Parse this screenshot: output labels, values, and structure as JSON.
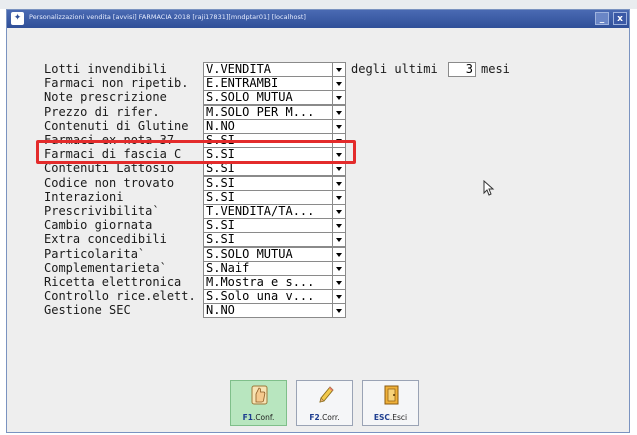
{
  "window": {
    "title": "Personalizzazioni vendita [avvisi] FARMACIA 2018 [raji17831][mndptar01] [localhost]",
    "icon": "app-icon",
    "minimize_label": "_",
    "close_label": "x"
  },
  "form": {
    "rows": [
      {
        "label": "Lotti invendibili",
        "value": "V.VENDITA"
      },
      {
        "label": "Farmaci non ripetib.",
        "value": "E.ENTRAMBI"
      },
      {
        "label": "Note prescrizione",
        "value": "S.SOLO MUTUA"
      },
      {
        "label": "Prezzo di rifer.",
        "value": "M.SOLO PER M..."
      },
      {
        "label": "Contenuti di Glutine",
        "value": "N.NO"
      },
      {
        "label": "Farmaci ex nota 37",
        "value": "S.SI"
      },
      {
        "label": "Farmaci di fascia C",
        "value": "S.SI"
      },
      {
        "label": "Contenuti Lattosio",
        "value": "S.SI"
      },
      {
        "label": "Codice non trovato",
        "value": "S.SI"
      },
      {
        "label": "Interazioni",
        "value": "S.SI"
      },
      {
        "label": "Prescrivibilita`",
        "value": "T.VENDITA/TA..."
      },
      {
        "label": "Cambio giornata",
        "value": "S.SI"
      },
      {
        "label": "Extra concedibili",
        "value": "S.SI"
      },
      {
        "label": "Particolarita`",
        "value": "S.SOLO MUTUA"
      },
      {
        "label": "Complementarieta`",
        "value": "S.Naif"
      },
      {
        "label": "Ricetta elettronica",
        "value": "M.Mostra e s..."
      },
      {
        "label": "Controllo rice.elett.",
        "value": "S.Solo una v..."
      },
      {
        "label": "Gestione SEC",
        "value": "N.NO"
      }
    ],
    "lotti_extra": {
      "prefix": "degli ultimi",
      "value": "3",
      "suffix": "mesi"
    },
    "highlighted_row": "Farmaci ex nota 37"
  },
  "buttons": [
    {
      "key": "F1",
      "label": ".Conf.",
      "icon": "thumbs-up-icon"
    },
    {
      "key": "F2",
      "label": ".Corr.",
      "icon": "pencil-icon"
    },
    {
      "key": "ESC",
      "label": ".Esci",
      "icon": "exit-door-icon"
    }
  ],
  "colors": {
    "highlight": "#e32b2b",
    "titlebar": "#2f4f98",
    "active_button": "#b8e6bf"
  }
}
